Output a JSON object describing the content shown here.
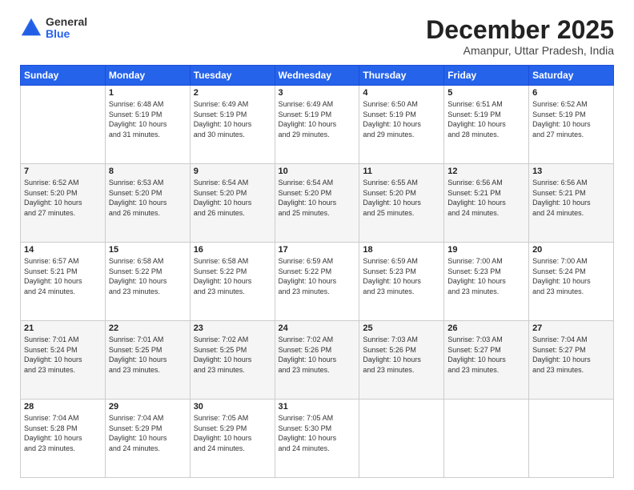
{
  "logo": {
    "general": "General",
    "blue": "Blue"
  },
  "title": "December 2025",
  "location": "Amanpur, Uttar Pradesh, India",
  "headers": [
    "Sunday",
    "Monday",
    "Tuesday",
    "Wednesday",
    "Thursday",
    "Friday",
    "Saturday"
  ],
  "weeks": [
    [
      {
        "day": "",
        "info": ""
      },
      {
        "day": "1",
        "info": "Sunrise: 6:48 AM\nSunset: 5:19 PM\nDaylight: 10 hours\nand 31 minutes."
      },
      {
        "day": "2",
        "info": "Sunrise: 6:49 AM\nSunset: 5:19 PM\nDaylight: 10 hours\nand 30 minutes."
      },
      {
        "day": "3",
        "info": "Sunrise: 6:49 AM\nSunset: 5:19 PM\nDaylight: 10 hours\nand 29 minutes."
      },
      {
        "day": "4",
        "info": "Sunrise: 6:50 AM\nSunset: 5:19 PM\nDaylight: 10 hours\nand 29 minutes."
      },
      {
        "day": "5",
        "info": "Sunrise: 6:51 AM\nSunset: 5:19 PM\nDaylight: 10 hours\nand 28 minutes."
      },
      {
        "day": "6",
        "info": "Sunrise: 6:52 AM\nSunset: 5:19 PM\nDaylight: 10 hours\nand 27 minutes."
      }
    ],
    [
      {
        "day": "7",
        "info": "Sunrise: 6:52 AM\nSunset: 5:20 PM\nDaylight: 10 hours\nand 27 minutes."
      },
      {
        "day": "8",
        "info": "Sunrise: 6:53 AM\nSunset: 5:20 PM\nDaylight: 10 hours\nand 26 minutes."
      },
      {
        "day": "9",
        "info": "Sunrise: 6:54 AM\nSunset: 5:20 PM\nDaylight: 10 hours\nand 26 minutes."
      },
      {
        "day": "10",
        "info": "Sunrise: 6:54 AM\nSunset: 5:20 PM\nDaylight: 10 hours\nand 25 minutes."
      },
      {
        "day": "11",
        "info": "Sunrise: 6:55 AM\nSunset: 5:20 PM\nDaylight: 10 hours\nand 25 minutes."
      },
      {
        "day": "12",
        "info": "Sunrise: 6:56 AM\nSunset: 5:21 PM\nDaylight: 10 hours\nand 24 minutes."
      },
      {
        "day": "13",
        "info": "Sunrise: 6:56 AM\nSunset: 5:21 PM\nDaylight: 10 hours\nand 24 minutes."
      }
    ],
    [
      {
        "day": "14",
        "info": "Sunrise: 6:57 AM\nSunset: 5:21 PM\nDaylight: 10 hours\nand 24 minutes."
      },
      {
        "day": "15",
        "info": "Sunrise: 6:58 AM\nSunset: 5:22 PM\nDaylight: 10 hours\nand 23 minutes."
      },
      {
        "day": "16",
        "info": "Sunrise: 6:58 AM\nSunset: 5:22 PM\nDaylight: 10 hours\nand 23 minutes."
      },
      {
        "day": "17",
        "info": "Sunrise: 6:59 AM\nSunset: 5:22 PM\nDaylight: 10 hours\nand 23 minutes."
      },
      {
        "day": "18",
        "info": "Sunrise: 6:59 AM\nSunset: 5:23 PM\nDaylight: 10 hours\nand 23 minutes."
      },
      {
        "day": "19",
        "info": "Sunrise: 7:00 AM\nSunset: 5:23 PM\nDaylight: 10 hours\nand 23 minutes."
      },
      {
        "day": "20",
        "info": "Sunrise: 7:00 AM\nSunset: 5:24 PM\nDaylight: 10 hours\nand 23 minutes."
      }
    ],
    [
      {
        "day": "21",
        "info": "Sunrise: 7:01 AM\nSunset: 5:24 PM\nDaylight: 10 hours\nand 23 minutes."
      },
      {
        "day": "22",
        "info": "Sunrise: 7:01 AM\nSunset: 5:25 PM\nDaylight: 10 hours\nand 23 minutes."
      },
      {
        "day": "23",
        "info": "Sunrise: 7:02 AM\nSunset: 5:25 PM\nDaylight: 10 hours\nand 23 minutes."
      },
      {
        "day": "24",
        "info": "Sunrise: 7:02 AM\nSunset: 5:26 PM\nDaylight: 10 hours\nand 23 minutes."
      },
      {
        "day": "25",
        "info": "Sunrise: 7:03 AM\nSunset: 5:26 PM\nDaylight: 10 hours\nand 23 minutes."
      },
      {
        "day": "26",
        "info": "Sunrise: 7:03 AM\nSunset: 5:27 PM\nDaylight: 10 hours\nand 23 minutes."
      },
      {
        "day": "27",
        "info": "Sunrise: 7:04 AM\nSunset: 5:27 PM\nDaylight: 10 hours\nand 23 minutes."
      }
    ],
    [
      {
        "day": "28",
        "info": "Sunrise: 7:04 AM\nSunset: 5:28 PM\nDaylight: 10 hours\nand 23 minutes."
      },
      {
        "day": "29",
        "info": "Sunrise: 7:04 AM\nSunset: 5:29 PM\nDaylight: 10 hours\nand 24 minutes."
      },
      {
        "day": "30",
        "info": "Sunrise: 7:05 AM\nSunset: 5:29 PM\nDaylight: 10 hours\nand 24 minutes."
      },
      {
        "day": "31",
        "info": "Sunrise: 7:05 AM\nSunset: 5:30 PM\nDaylight: 10 hours\nand 24 minutes."
      },
      {
        "day": "",
        "info": ""
      },
      {
        "day": "",
        "info": ""
      },
      {
        "day": "",
        "info": ""
      }
    ]
  ]
}
